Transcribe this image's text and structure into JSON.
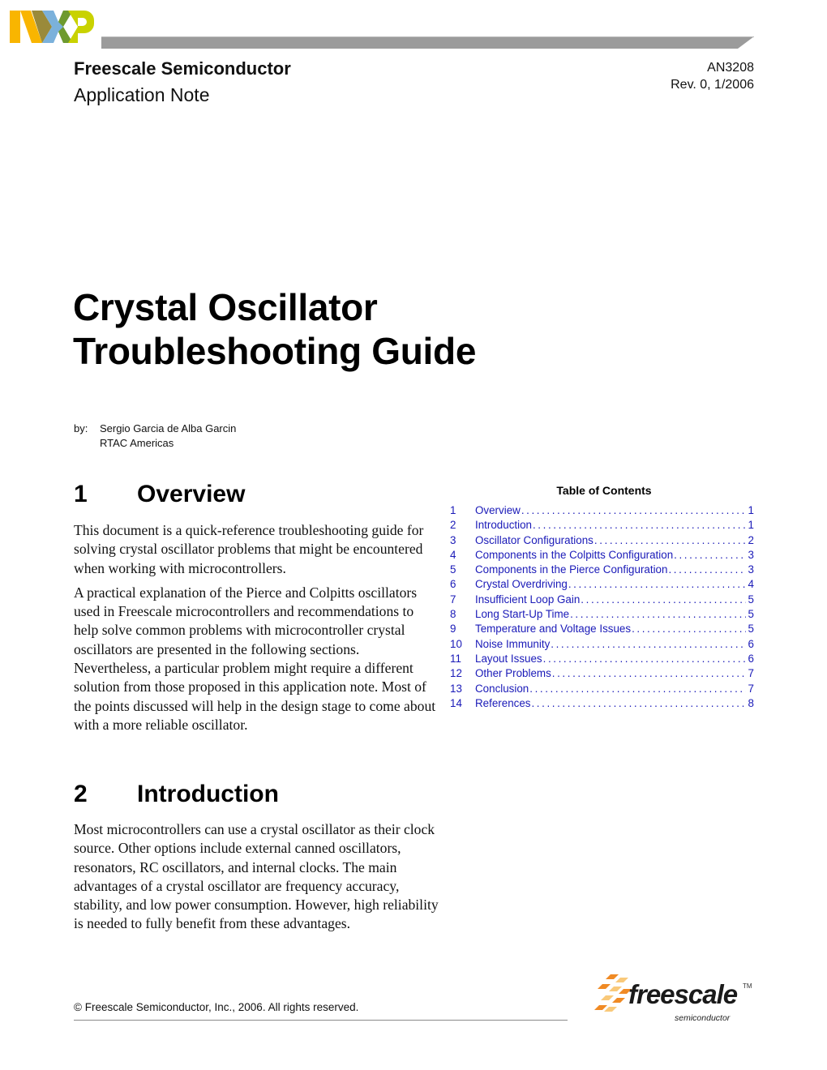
{
  "header": {
    "logo_name": "NXP",
    "company": "Freescale Semiconductor",
    "document_type": "Application Note",
    "document_id": "AN3208",
    "revision": "Rev. 0, 1/2006",
    "colors": {
      "logo_orange": "#F9B500",
      "logo_olive": "#9A8A3A",
      "logo_blue": "#7BB1DB",
      "logo_green": "#6E9A2E",
      "logo_lime": "#C9D200",
      "bar": "#9B9B9B"
    }
  },
  "title": {
    "line1": "Crystal Oscillator",
    "line2": "Troubleshooting Guide"
  },
  "byline": {
    "by_label": "by:",
    "author": "Sergio Garcia de Alba Garcin",
    "organization": "RTAC Americas"
  },
  "sections": [
    {
      "number": "1",
      "heading": "Overview",
      "paragraphs": [
        "This document is a quick-reference troubleshooting guide for solving crystal oscillator problems that might be encountered when working with microcontrollers.",
        "A practical explanation of the Pierce and Colpitts oscillators used in Freescale microcontrollers and recommendations to help solve common problems with microcontroller crystal oscillators are presented in the following sections. Nevertheless, a particular problem might require a different solution from those proposed in this application note. Most of the points discussed will help in the design stage to come about with a more reliable oscillator."
      ]
    },
    {
      "number": "2",
      "heading": "Introduction",
      "paragraphs": [
        "Most microcontrollers can use a crystal oscillator as their clock source. Other options include external canned oscillators, resonators, RC oscillators, and internal clocks. The main advantages of a crystal oscillator are frequency accuracy, stability, and low power consumption. However, high reliability is needed to fully benefit from these advantages."
      ]
    }
  ],
  "toc": {
    "title": "Table of Contents",
    "link_color": "#1a1ab8",
    "entries": [
      {
        "num": "1",
        "label": "Overview",
        "page": "1"
      },
      {
        "num": "2",
        "label": "Introduction",
        "page": "1"
      },
      {
        "num": "3",
        "label": "Oscillator Configurations",
        "page": "2"
      },
      {
        "num": "4",
        "label": "Components in the Colpitts Configuration",
        "page": "3"
      },
      {
        "num": "5",
        "label": "Components in the Pierce Configuration",
        "page": "3"
      },
      {
        "num": "6",
        "label": "Crystal Overdriving",
        "page": "4"
      },
      {
        "num": "7",
        "label": "Insufficient Loop Gain",
        "page": "5"
      },
      {
        "num": "8",
        "label": "Long Start-Up Time",
        "page": "5"
      },
      {
        "num": "9",
        "label": "Temperature and Voltage Issues",
        "page": "5"
      },
      {
        "num": "10",
        "label": "Noise Immunity",
        "page": "6"
      },
      {
        "num": "11",
        "label": "Layout Issues",
        "page": "6"
      },
      {
        "num": "12",
        "label": "Other Problems",
        "page": "7"
      },
      {
        "num": "13",
        "label": "Conclusion",
        "page": "7"
      },
      {
        "num": "14",
        "label": "References",
        "page": "8"
      }
    ]
  },
  "footer": {
    "copyright": "© Freescale Semiconductor, Inc., 2006. All rights reserved.",
    "brand_word": "freescale",
    "brand_tm": "TM",
    "brand_sub": "semiconductor",
    "colors": {
      "mark_orange": "#F08A24",
      "mark_light": "#F9C97A"
    }
  }
}
